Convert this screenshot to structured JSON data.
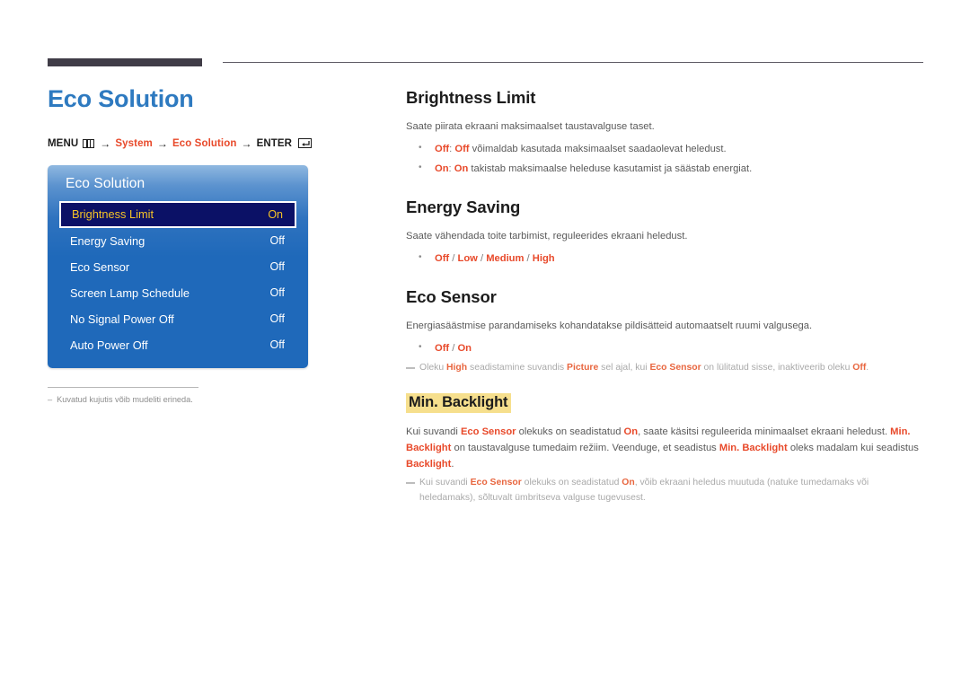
{
  "page": {
    "title": "Eco Solution",
    "breadcrumb": {
      "menu_label": "MENU",
      "menu_icon": "menu-grid-icon",
      "arrow": "→",
      "step1": "System",
      "step2": "Eco Solution",
      "enter_label": "ENTER",
      "enter_icon": "enter-return-icon"
    },
    "footnote": {
      "dash": "–",
      "text": "Kuvatud kujutis võib mudeliti erineda."
    }
  },
  "osd": {
    "title": "Eco Solution",
    "rows": [
      {
        "label": "Brightness Limit",
        "value": "On",
        "selected": true
      },
      {
        "label": "Energy Saving",
        "value": "Off",
        "selected": false
      },
      {
        "label": "Eco Sensor",
        "value": "Off",
        "selected": false
      },
      {
        "label": "Screen Lamp Schedule",
        "value": "Off",
        "selected": false
      },
      {
        "label": "No Signal Power Off",
        "value": "Off",
        "selected": false
      },
      {
        "label": "Auto Power Off",
        "value": "Off",
        "selected": false
      }
    ]
  },
  "sections": {
    "brightness_limit": {
      "heading": "Brightness Limit",
      "intro": "Saate piirata ekraani maksimaalset taustavalguse taset.",
      "bullet1_key": "Off",
      "bullet1_colon": ": ",
      "bullet1_key2": "Off",
      "bullet1_rest": " võimaldab kasutada maksimaalset saadaolevat heledust.",
      "bullet2_key": "On",
      "bullet2_colon": ": ",
      "bullet2_key2": "On",
      "bullet2_rest": " takistab maksimaalse heleduse kasutamist ja säästab energiat."
    },
    "energy_saving": {
      "heading": "Energy Saving",
      "intro": "Saate vähendada toite tarbimist, reguleerides ekraani heledust.",
      "opt1": "Off",
      "opt2": "Low",
      "opt3": "Medium",
      "opt4": "High",
      "sep": " / "
    },
    "eco_sensor": {
      "heading": "Eco Sensor",
      "intro": "Energiasäästmise parandamiseks kohandatakse pildisätteid automaatselt ruumi valgusega.",
      "opt1": "Off",
      "opt2": "On",
      "sep": " / ",
      "note_a": "Oleku ",
      "note_k1": "High",
      "note_b": " seadistamine suvandis ",
      "note_k2": "Picture",
      "note_c": " sel ajal, kui ",
      "note_k3": "Eco Sensor",
      "note_d": " on lülitatud sisse, inaktiveerib oleku ",
      "note_k4": "Off",
      "note_e": "."
    },
    "min_backlight": {
      "heading": "Min. Backlight",
      "p_a": "Kui suvandi ",
      "p_k1": "Eco Sensor",
      "p_b": " olekuks on seadistatud ",
      "p_k2": "On",
      "p_c": ", saate käsitsi reguleerida minimaalset ekraani heledust. ",
      "p_k3": "Min. Backlight",
      "p_d": " on taustavalguse tumedaim režiim. Veenduge, et seadistus ",
      "p_k4": "Min. Backlight",
      "p_e": " oleks madalam kui seadistus ",
      "p_k5": "Backlight",
      "p_f": ".",
      "note_a": "Kui suvandi ",
      "note_k1": "Eco Sensor",
      "note_b": " olekuks on seadistatud ",
      "note_k2": "On",
      "note_c": ", võib ekraani heledus muutuda (natuke tumedamaks või heledamaks), sõltuvalt ümbritseva valguse tugevusest."
    }
  }
}
